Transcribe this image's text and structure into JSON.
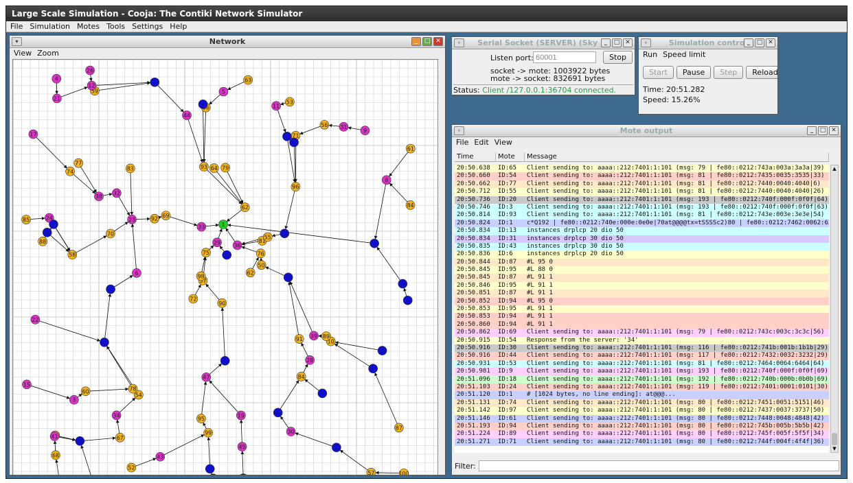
{
  "app": {
    "title": "Large Scale Simulation - Cooja: The Contiki Network Simulator"
  },
  "menubar": [
    "File",
    "Simulation",
    "Motes",
    "Tools",
    "Settings",
    "Help"
  ],
  "network": {
    "title": "Network",
    "menu": [
      "View",
      "Zoom"
    ],
    "nodes": [
      {
        "id": "90",
        "c": "y"
      },
      {
        "id": "74",
        "c": "y"
      },
      {
        "id": "57",
        "c": "y"
      },
      {
        "id": "66",
        "c": "y"
      },
      {
        "id": "81",
        "c": "y"
      },
      {
        "id": "54",
        "c": "y"
      },
      {
        "id": "53",
        "c": "y"
      },
      {
        "id": "79",
        "c": "y"
      },
      {
        "id": "71",
        "c": "y"
      },
      {
        "id": "62",
        "c": "y"
      },
      {
        "id": "59",
        "c": "y"
      },
      {
        "id": "100",
        "c": "y"
      },
      {
        "id": "58",
        "c": "y"
      },
      {
        "id": "61",
        "c": "y"
      },
      {
        "id": "72",
        "c": "y"
      },
      {
        "id": "96",
        "c": "y"
      },
      {
        "id": "65",
        "c": "y"
      },
      {
        "id": "93",
        "c": "y"
      },
      {
        "id": "62",
        "c": "y"
      },
      {
        "id": "60",
        "c": "y"
      },
      {
        "id": "69",
        "c": "y"
      },
      {
        "id": "68",
        "c": "y"
      },
      {
        "id": "67",
        "c": "y"
      },
      {
        "id": "64",
        "c": "y"
      },
      {
        "id": "55",
        "c": "y"
      },
      {
        "id": "10",
        "c": "y"
      },
      {
        "id": "77",
        "c": "y"
      },
      {
        "id": "86",
        "c": "y"
      },
      {
        "id": "88",
        "c": "y"
      },
      {
        "id": "91",
        "c": "y"
      },
      {
        "id": "84",
        "c": "y"
      },
      {
        "id": "98",
        "c": "y"
      },
      {
        "id": "95",
        "c": "y"
      },
      {
        "id": "75",
        "c": "y"
      },
      {
        "id": "83",
        "c": "y"
      },
      {
        "id": "56",
        "c": "y"
      },
      {
        "id": "78",
        "c": "y"
      },
      {
        "id": "57",
        "c": "y"
      },
      {
        "id": "87",
        "c": "y"
      },
      {
        "id": "89",
        "c": "y"
      },
      {
        "id": "63",
        "c": "y"
      },
      {
        "id": "92",
        "c": "y"
      },
      {
        "id": "70",
        "c": "y"
      },
      {
        "id": "84",
        "c": "y"
      },
      {
        "id": "52",
        "c": "y"
      },
      {
        "id": "85",
        "c": "y"
      },
      {
        "id": "76",
        "c": "y"
      },
      {
        "id": "73",
        "c": "y"
      },
      {
        "id": "99",
        "c": "y"
      },
      {
        "id": "50",
        "c": "y"
      },
      {
        "id": "3",
        "c": "m"
      },
      {
        "id": "8",
        "c": "m"
      },
      {
        "id": "17",
        "c": "m"
      },
      {
        "id": "28",
        "c": "m"
      },
      {
        "id": "30",
        "c": "m"
      },
      {
        "id": "34",
        "c": "m"
      },
      {
        "id": "12",
        "c": "m"
      },
      {
        "id": "4",
        "c": "m"
      },
      {
        "id": "19",
        "c": "m"
      },
      {
        "id": "9",
        "c": "m"
      },
      {
        "id": "5",
        "c": "m"
      },
      {
        "id": "6",
        "c": "m"
      },
      {
        "id": "24",
        "c": "m"
      },
      {
        "id": "32",
        "c": "m"
      },
      {
        "id": "31",
        "c": "m"
      },
      {
        "id": "26",
        "c": "m"
      },
      {
        "id": "11",
        "c": "m"
      },
      {
        "id": "44",
        "c": "m"
      },
      {
        "id": "29",
        "c": "m"
      },
      {
        "id": "15",
        "c": "m"
      },
      {
        "id": "47",
        "c": "m"
      },
      {
        "id": "43",
        "c": "m"
      },
      {
        "id": "39",
        "c": "m"
      },
      {
        "id": "23",
        "c": "m"
      },
      {
        "id": "41",
        "c": "m"
      },
      {
        "id": "21",
        "c": "m"
      },
      {
        "id": "38",
        "c": "m"
      },
      {
        "id": "22",
        "c": "m"
      },
      {
        "id": "33",
        "c": "m"
      },
      {
        "id": "45",
        "c": "m"
      },
      {
        "id": "36",
        "c": "m"
      },
      {
        "id": "1",
        "c": "g"
      }
    ]
  },
  "serial": {
    "title": "Serial Socket (SERVER) (Sky 1)",
    "listen_label": "Listen port:",
    "listen_value": "60001",
    "stop": "Stop",
    "line1": "socket -> mote: 1003922 bytes",
    "line2": "mote -> socket: 832691 bytes",
    "status_label": "Status:",
    "status_value": "Client /127.0.0.1:36704 connected."
  },
  "simctl": {
    "title": "Simulation control",
    "menu": [
      "Run",
      "Speed limit"
    ],
    "buttons": [
      "Start",
      "Pause",
      "Step",
      "Reload"
    ],
    "time": "Time: 20:51.282",
    "speed": "Speed: 15.26%"
  },
  "moteout": {
    "title": "Mote output",
    "menu": [
      "File",
      "Edit",
      "View"
    ],
    "headers": [
      "Time",
      "Mote",
      "Message"
    ],
    "filter_label": "Filter:",
    "rows": [
      {
        "t": "20:50.638",
        "m": "ID:65",
        "msg": "Client sending to: aaaa::212:7401:1:101 (msg: 79 | fe80::0212:743a:003a:3a3a|39)",
        "bg": "#ffffcc"
      },
      {
        "t": "20:50.660",
        "m": "ID:54",
        "msg": "Client sending to: aaaa::212:7401:1:101 (msg: 81 | fe80::0212:7435:0035:3535|33)",
        "bg": "#ffd0c8"
      },
      {
        "t": "20:50.662",
        "m": "ID:77",
        "msg": "Client sending to: aaaa::212:7401:1:101 (msg: 81 | fe80::0212:7440:0040:4040|6)",
        "bg": "#ffe8c8"
      },
      {
        "t": "20:50.712",
        "m": "ID:55",
        "msg": "Client sending to: aaaa::212:7401:1:101 (msg: 81 | fe80::0212:7440:0040:4040|26)",
        "bg": "#ffffcc"
      },
      {
        "t": "20:50.736",
        "m": "ID:20",
        "msg": "Client sending to: aaaa::212:7401:1:101 (msg: 193 | fe80::0212:740f:000f:0f0f|64)",
        "bg": "#c8c8c8"
      },
      {
        "t": "20:50.746",
        "m": "ID:3",
        "msg": "Client sending to: aaaa::212:7401:1:101 (msg: 193 | fe80::0212:740f:000f:0f0f|63)",
        "bg": "#ccffff"
      },
      {
        "t": "20:50.814",
        "m": "ID:93",
        "msg": "Client sending to: aaaa::212:7401:1:101 (msg: 81 | fe80::0212:743e:003e:3e3e|54)",
        "bg": "#ccffff"
      },
      {
        "t": "20:50.824",
        "m": "ID:1",
        "msg": "c*Q192 | fe80::0212:740e:000e:0e0e|70at@@@@tx=tSSSSc2)80 | fe80::0212:7462:0062:62...",
        "bg": "#c8d0ff"
      },
      {
        "t": "20:50.834",
        "m": "ID:13",
        "msg": "instances drplcp 20 dio 50",
        "bg": "#ccffff"
      },
      {
        "t": "20:50.834",
        "m": "ID:31",
        "msg": "instances drplcp 30 dio 50",
        "bg": "#d8c8ff"
      },
      {
        "t": "20:50.835",
        "m": "ID:43",
        "msg": "instances drplcp 30 dio 50",
        "bg": "#ccffff"
      },
      {
        "t": "20:50.836",
        "m": "ID:6",
        "msg": "instances drplcp 20 dio 50",
        "bg": "#ffffcc"
      },
      {
        "t": "20:50.844",
        "m": "ID:87",
        "msg": "#L 95 0",
        "bg": "#ffe8c8"
      },
      {
        "t": "20:50.845",
        "m": "ID:95",
        "msg": "#L 88 0",
        "bg": "#ffffcc"
      },
      {
        "t": "20:50.845",
        "m": "ID:87",
        "msg": "#L 91 1",
        "bg": "#ffe8c8"
      },
      {
        "t": "20:50.846",
        "m": "ID:95",
        "msg": "#L 91 1",
        "bg": "#ffffcc"
      },
      {
        "t": "20:50.851",
        "m": "ID:87",
        "msg": "#L 91 1",
        "bg": "#ffe8c8"
      },
      {
        "t": "20:50.852",
        "m": "ID:94",
        "msg": "#L 95 0",
        "bg": "#ffd0c8"
      },
      {
        "t": "20:50.853",
        "m": "ID:95",
        "msg": "#L 91 1",
        "bg": "#ffffcc"
      },
      {
        "t": "20:50.853",
        "m": "ID:94",
        "msg": "#L 91 1",
        "bg": "#ffd0c8"
      },
      {
        "t": "20:50.860",
        "m": "ID:94",
        "msg": "#L 91 1",
        "bg": "#ffd0c8"
      },
      {
        "t": "20:50.862",
        "m": "ID:69",
        "msg": "Client sending to: aaaa::212:7401:1:101 (msg: 79 | fe80::0212:743c:003c:3c3c|56)",
        "bg": "#ffd0ff"
      },
      {
        "t": "20:50.915",
        "m": "ID:54",
        "msg": "Response from the server: '34'",
        "bg": "#ffffcc"
      },
      {
        "t": "20:50.916",
        "m": "ID:30",
        "msg": "Client sending to: aaaa::212:7401:1:101 (msg: 116 | fe80::0212:741b:001b:1b1b|29)",
        "bg": "#c8c8c8"
      },
      {
        "t": "20:50.916",
        "m": "ID:44",
        "msg": "Client sending to: aaaa::212:7401:1:101 (msg: 117 | fe80::0212:7432:0032:3232|29)",
        "bg": "#ffd0c8"
      },
      {
        "t": "20:50.931",
        "m": "ID:53",
        "msg": "Client sending to: aaaa::212:7401:1:101 (msg: 81 | fe80::0212:7464:0064:6464|64)",
        "bg": "#ccffff"
      },
      {
        "t": "20:50.981",
        "m": "ID:9",
        "msg": "Client sending to: aaaa::212:7401:1:101 (msg: 193 | fe80::0212:740f:000f:0f0f|69)",
        "bg": "#ffd0ff"
      },
      {
        "t": "20:51.096",
        "m": "ID:18",
        "msg": "Client sending to: aaaa::212:7401:1:101 (msg: 192 | fe80::0212:740b:000b:0b0b|69)",
        "bg": "#ccffcc"
      },
      {
        "t": "20:51.103",
        "m": "ID:24",
        "msg": "Client sending to: aaaa::212:7401:1:101 (msg: 119 | fe80::0212:7401:0001:0101|30)",
        "bg": "#ffd0c8"
      },
      {
        "t": "20:51.120",
        "m": "ID:1",
        "msg": "# [1024 bytes, no line ending]: at@@@...",
        "bg": "#c8d0ff"
      },
      {
        "t": "20:51.131",
        "m": "ID:74",
        "msg": "Client sending to: aaaa::212:7401:1:101 (msg: 80 | fe80::0212:7451:0051:5151|46)",
        "bg": "#ffe8c8"
      },
      {
        "t": "20:51.142",
        "m": "ID:97",
        "msg": "Client sending to: aaaa::212:7401:1:101 (msg: 80 | fe80::0212:7437:0037:3737|50)",
        "bg": "#ffffcc"
      },
      {
        "t": "20:51.146",
        "m": "ID:61",
        "msg": "Client sending to: aaaa::212:7401:1:101 (msg: 80 | fe80::0212:7448:0048:4848|42)",
        "bg": "#c8d0ff"
      },
      {
        "t": "20:51.193",
        "m": "ID:94",
        "msg": "Client sending to: aaaa::212:7401:1:101 (msg: 80 | fe80::0212:745b:005b:5b5b|42)",
        "bg": "#ffd0c8"
      },
      {
        "t": "20:51.224",
        "m": "ID:89",
        "msg": "Client sending to: aaaa::212:7401:1:101 (msg: 80 | fe80::0212:745f:005f:5f5f|34)",
        "bg": "#ffd0ff"
      },
      {
        "t": "20:51.271",
        "m": "ID:71",
        "msg": "Client sending to: aaaa::212:7401:1:101 (msg: 80 | fe80::0212:744f:004f:4f4f|36)",
        "bg": "#c8d0ff"
      }
    ]
  },
  "colors": {
    "yellow": "#f2b21b",
    "magenta": "#d933c6",
    "blue": "#1010c8",
    "green": "#22cc22",
    "status_green": "#2a9a4a"
  }
}
